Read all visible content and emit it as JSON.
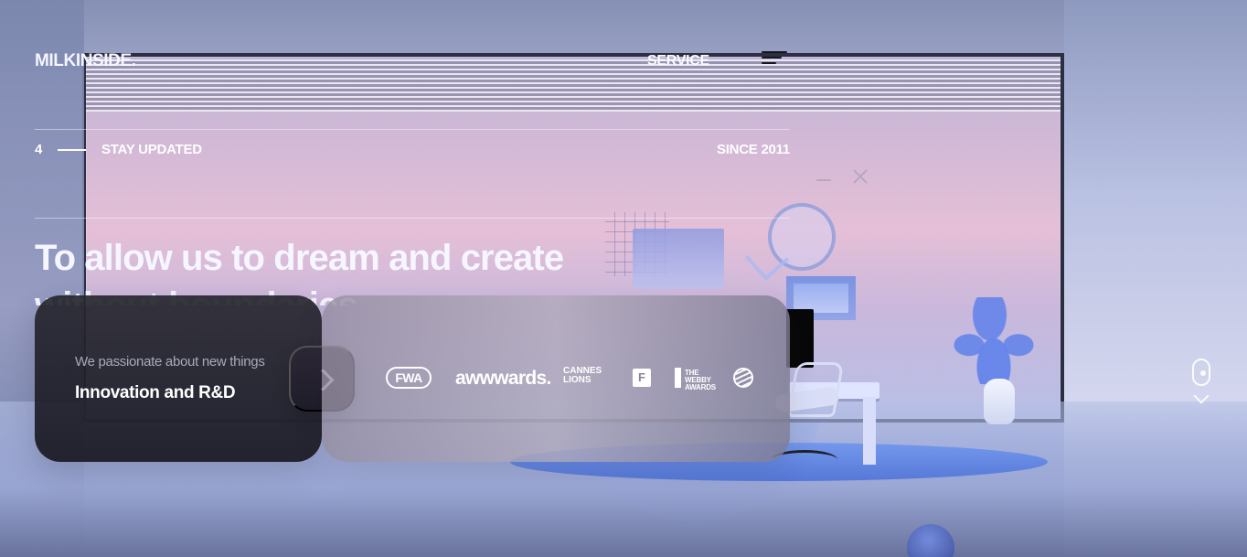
{
  "header": {
    "brand": "MILKINSIDE.",
    "service_label": "SERVICE",
    "menu_icon": "menu-icon"
  },
  "meta": {
    "slide_number": "4",
    "stay_updated": "STAY UPDATED",
    "since": "SINCE 2011"
  },
  "hero": {
    "headline": "To allow us to dream and create without boundaries"
  },
  "feature_card": {
    "kicker": "We passionate about new things",
    "title": "Innovation and R&D",
    "next_icon": "chevron-right-icon"
  },
  "awards": {
    "items": [
      {
        "name": "fwa-logo",
        "label": "FWA"
      },
      {
        "name": "awwwards-logo",
        "label": "awwwards."
      },
      {
        "name": "cannes-lions-logo",
        "label": "CANNES LIONS"
      },
      {
        "name": "f-award-logo",
        "label": "F"
      },
      {
        "name": "webby-awards-logo",
        "label": "THE WEBBY AWARDS"
      },
      {
        "name": "globe-award-logo",
        "label": ""
      }
    ]
  },
  "scroll": {
    "mouse_icon": "mouse-scroll-icon",
    "chevron_icon": "chevron-down-icon"
  },
  "colors": {
    "card_dark": "#26252F",
    "card_light": "#9E97AA",
    "text_primary": "#FFFFFF",
    "text_muted": "#AAA9B9",
    "accent_floor": "#5B7FE0"
  }
}
